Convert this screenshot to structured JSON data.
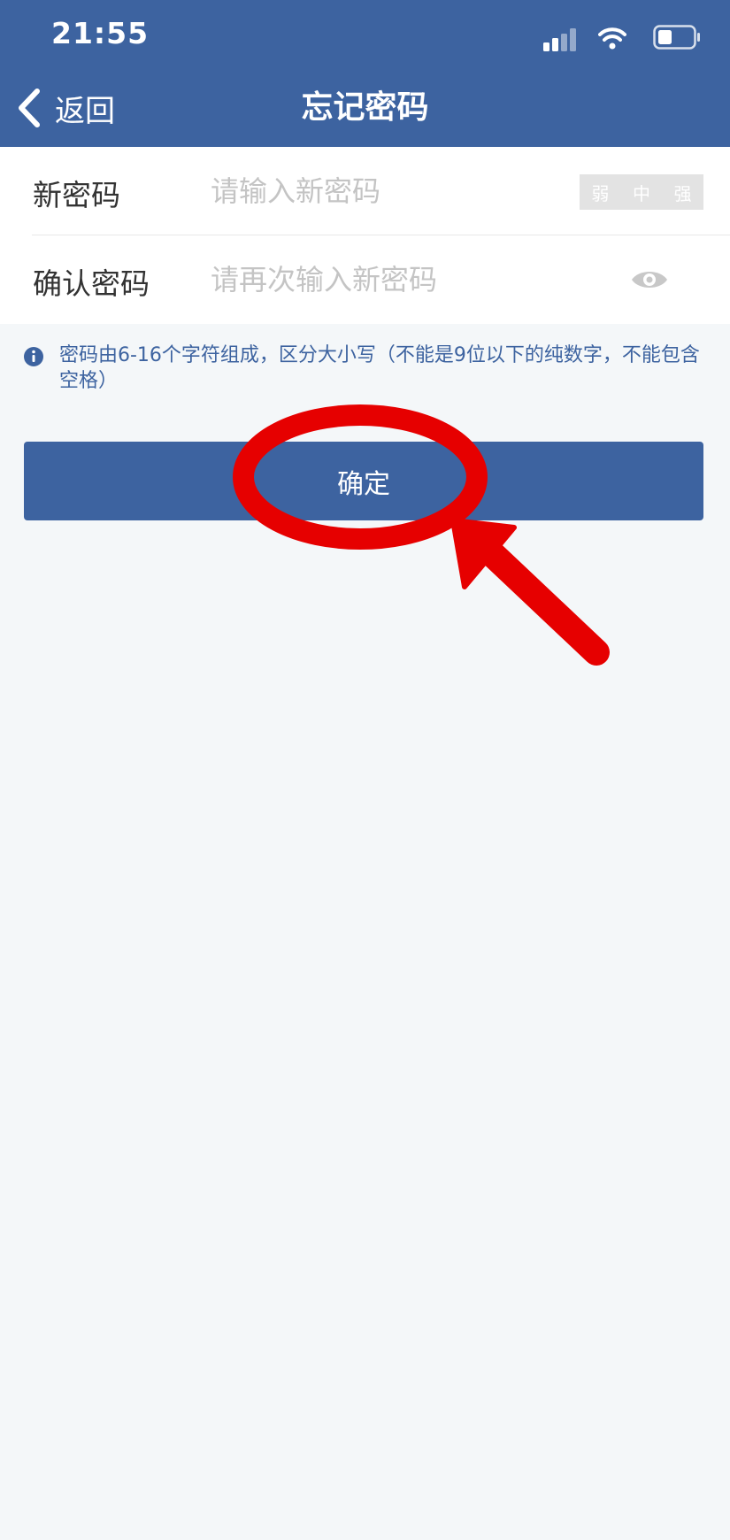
{
  "status_bar": {
    "time": "21:55",
    "icons": [
      "signal-icon",
      "wifi-icon",
      "battery-icon"
    ]
  },
  "nav": {
    "back_label": "返回",
    "title": "忘记密码"
  },
  "form": {
    "new_password": {
      "label": "新密码",
      "placeholder": "请输入新密码",
      "value": ""
    },
    "strength": {
      "weak": "弱",
      "medium": "中",
      "strong": "强"
    },
    "confirm_password": {
      "label": "确认密码",
      "placeholder": "请再次输入新密码",
      "value": ""
    }
  },
  "hint": {
    "icon": "info-icon",
    "text": "密码由6-16个字符组成，区分大小写（不能是9位以下的纯数字，不能包含空格）"
  },
  "confirm_button_label": "确定",
  "colors": {
    "brand": "#3d63a0",
    "background": "#f4f7f9",
    "annotation": "#e60000",
    "placeholder": "#c4c4c4"
  }
}
